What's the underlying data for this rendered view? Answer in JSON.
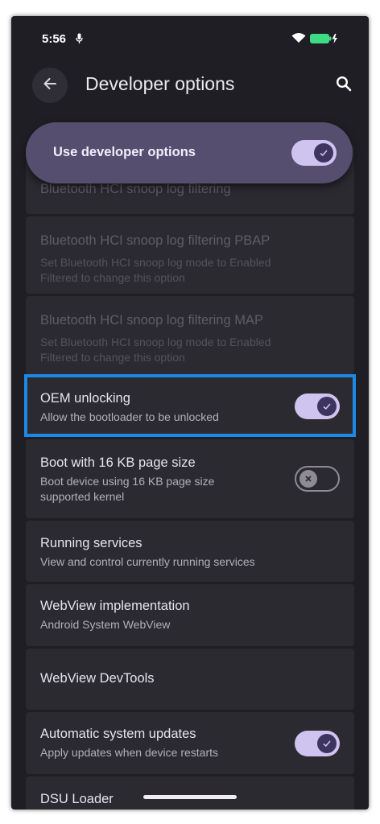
{
  "status_bar": {
    "time": "5:56",
    "mic_icon": "mic-icon",
    "wifi_icon": "wifi-icon",
    "battery_icon": "battery-charging-icon",
    "battery_color": "#3ddc84"
  },
  "app_bar": {
    "title": "Developer options",
    "back_icon": "arrow-back-icon",
    "search_icon": "search-icon"
  },
  "master_switch": {
    "label": "Use developer options",
    "enabled": true
  },
  "settings": [
    {
      "title": "Bluetooth HCI snoop log filtering",
      "subtitle": "",
      "disabled": true,
      "toggle": null
    },
    {
      "title": "Bluetooth HCI snoop log filtering PBAP",
      "subtitle": "Set Bluetooth HCI snoop log mode to Enabled\nFiltered to change this option",
      "disabled": true,
      "toggle": null
    },
    {
      "title": "Bluetooth HCI snoop log filtering MAP",
      "subtitle": "Set Bluetooth HCI snoop log mode to Enabled\nFiltered to change this option",
      "disabled": true,
      "toggle": null
    },
    {
      "title": "OEM unlocking",
      "subtitle": "Allow the bootloader to be unlocked",
      "disabled": false,
      "toggle": true
    },
    {
      "title": "Boot with 16 KB page size",
      "subtitle": "Boot device using 16 KB page size\nsupported kernel",
      "disabled": false,
      "toggle": false
    },
    {
      "title": "Running services",
      "subtitle": "View and control currently running services",
      "disabled": false,
      "toggle": null
    },
    {
      "title": "WebView implementation",
      "subtitle": "Android System WebView",
      "disabled": false,
      "toggle": null
    },
    {
      "title": "WebView DevTools",
      "subtitle": "",
      "disabled": false,
      "toggle": null
    },
    {
      "title": "Automatic system updates",
      "subtitle": "Apply updates when device restarts",
      "disabled": false,
      "toggle": true
    },
    {
      "title": "DSU Loader",
      "subtitle": "",
      "disabled": false,
      "toggle": null
    }
  ],
  "colors": {
    "background": "#1f1e24",
    "card": "#2b2a31",
    "accent_toggle": "#cfc3f0",
    "highlight": "#1e88e5"
  }
}
